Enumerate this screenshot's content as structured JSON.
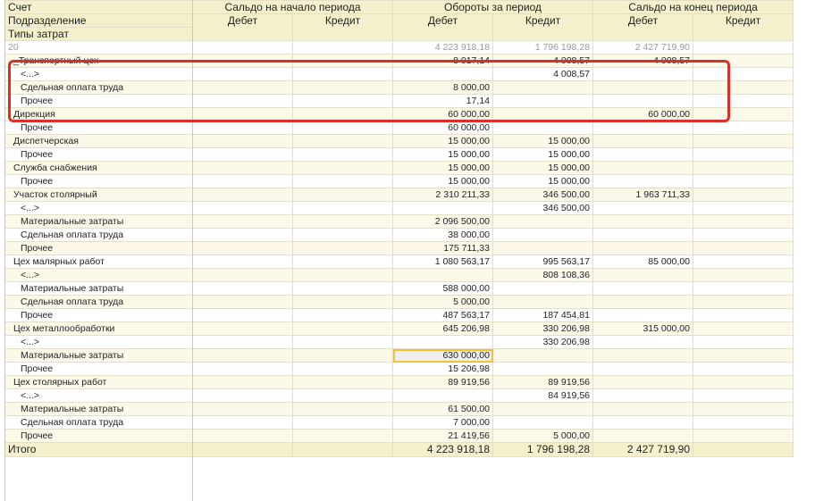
{
  "header": {
    "col_account": "Счет",
    "col_department": "Подразделение",
    "col_cost_type": "Типы затрат",
    "group_opening": "Сальдо на начало периода",
    "group_turnover": "Обороты за период",
    "group_closing": "Сальдо на конец периода",
    "debit": "Дебет",
    "credit": "Кредит"
  },
  "rows": [
    {
      "level": 0,
      "label": "20",
      "od": "",
      "oc": "",
      "td": "4 223 918,18",
      "tc": "1 796 198,28",
      "cd": "2 427 719,90",
      "cc": ""
    },
    {
      "level": 1,
      "label": "_Транспортный цех",
      "od": "",
      "oc": "",
      "td": "8 017,14",
      "tc": "4 008,57",
      "cd": "4 008,57",
      "cc": ""
    },
    {
      "level": 2,
      "label": "<...>",
      "od": "",
      "oc": "",
      "td": "",
      "tc": "4 008,57",
      "cd": "",
      "cc": ""
    },
    {
      "level": 2,
      "label": "Сдельная оплата труда",
      "od": "",
      "oc": "",
      "td": "8 000,00",
      "tc": "",
      "cd": "",
      "cc": ""
    },
    {
      "level": 2,
      "label": "Прочее",
      "od": "",
      "oc": "",
      "td": "17,14",
      "tc": "",
      "cd": "",
      "cc": ""
    },
    {
      "level": 1,
      "label": "Дирекция",
      "od": "",
      "oc": "",
      "td": "60 000,00",
      "tc": "",
      "cd": "60 000,00",
      "cc": ""
    },
    {
      "level": 2,
      "label": "Прочее",
      "od": "",
      "oc": "",
      "td": "60 000,00",
      "tc": "",
      "cd": "",
      "cc": ""
    },
    {
      "level": 1,
      "label": "Диспетчерская",
      "od": "",
      "oc": "",
      "td": "15 000,00",
      "tc": "15 000,00",
      "cd": "",
      "cc": ""
    },
    {
      "level": 2,
      "label": "Прочее",
      "od": "",
      "oc": "",
      "td": "15 000,00",
      "tc": "15 000,00",
      "cd": "",
      "cc": ""
    },
    {
      "level": 1,
      "label": "Служба снабжения",
      "od": "",
      "oc": "",
      "td": "15 000,00",
      "tc": "15 000,00",
      "cd": "",
      "cc": ""
    },
    {
      "level": 2,
      "label": "Прочее",
      "od": "",
      "oc": "",
      "td": "15 000,00",
      "tc": "15 000,00",
      "cd": "",
      "cc": ""
    },
    {
      "level": 1,
      "label": "Участок столярный",
      "od": "",
      "oc": "",
      "td": "2 310 211,33",
      "tc": "346 500,00",
      "cd": "1 963 711,33",
      "cc": ""
    },
    {
      "level": 2,
      "label": "<...>",
      "od": "",
      "oc": "",
      "td": "",
      "tc": "346 500,00",
      "cd": "",
      "cc": ""
    },
    {
      "level": 2,
      "label": "Материальные затраты",
      "od": "",
      "oc": "",
      "td": "2 096 500,00",
      "tc": "",
      "cd": "",
      "cc": ""
    },
    {
      "level": 2,
      "label": "Сдельная оплата труда",
      "od": "",
      "oc": "",
      "td": "38 000,00",
      "tc": "",
      "cd": "",
      "cc": ""
    },
    {
      "level": 2,
      "label": "Прочее",
      "od": "",
      "oc": "",
      "td": "175 711,33",
      "tc": "",
      "cd": "",
      "cc": ""
    },
    {
      "level": 1,
      "label": "Цех малярных работ",
      "od": "",
      "oc": "",
      "td": "1 080 563,17",
      "tc": "995 563,17",
      "cd": "85 000,00",
      "cc": ""
    },
    {
      "level": 2,
      "label": "<...>",
      "od": "",
      "oc": "",
      "td": "",
      "tc": "808 108,36",
      "cd": "",
      "cc": ""
    },
    {
      "level": 2,
      "label": "Материальные затраты",
      "od": "",
      "oc": "",
      "td": "588 000,00",
      "tc": "",
      "cd": "",
      "cc": ""
    },
    {
      "level": 2,
      "label": "Сдельная оплата труда",
      "od": "",
      "oc": "",
      "td": "5 000,00",
      "tc": "",
      "cd": "",
      "cc": ""
    },
    {
      "level": 2,
      "label": "Прочее",
      "od": "",
      "oc": "",
      "td": "487 563,17",
      "tc": "187 454,81",
      "cd": "",
      "cc": ""
    },
    {
      "level": 1,
      "label": "Цех металлообработки",
      "od": "",
      "oc": "",
      "td": "645 206,98",
      "tc": "330 206,98",
      "cd": "315 000,00",
      "cc": ""
    },
    {
      "level": 2,
      "label": "<...>",
      "od": "",
      "oc": "",
      "td": "",
      "tc": "330 206,98",
      "cd": "",
      "cc": ""
    },
    {
      "level": 2,
      "label": "Материальные затраты",
      "od": "",
      "oc": "",
      "td": "630 000,00",
      "tc": "",
      "cd": "",
      "cc": "",
      "selected": true
    },
    {
      "level": 2,
      "label": "Прочее",
      "od": "",
      "oc": "",
      "td": "15 206,98",
      "tc": "",
      "cd": "",
      "cc": ""
    },
    {
      "level": 1,
      "label": "Цех столярных работ",
      "od": "",
      "oc": "",
      "td": "89 919,56",
      "tc": "89 919,56",
      "cd": "",
      "cc": ""
    },
    {
      "level": 2,
      "label": "<...>",
      "od": "",
      "oc": "",
      "td": "",
      "tc": "84 919,56",
      "cd": "",
      "cc": ""
    },
    {
      "level": 2,
      "label": "Материальные затраты",
      "od": "",
      "oc": "",
      "td": "61 500,00",
      "tc": "",
      "cd": "",
      "cc": ""
    },
    {
      "level": 2,
      "label": "Сдельная оплата труда",
      "od": "",
      "oc": "",
      "td": "7 000,00",
      "tc": "",
      "cd": "",
      "cc": ""
    },
    {
      "level": 2,
      "label": "Прочее",
      "od": "",
      "oc": "",
      "td": "21 419,56",
      "tc": "5 000,00",
      "cd": "",
      "cc": ""
    }
  ],
  "total": {
    "label": "Итого",
    "td": "4 223 918,18",
    "tc": "1 796 198,28",
    "cd": "2 427 719,90"
  },
  "colors": {
    "header_bg": "#f5f0cc",
    "highlight": "#d8302a",
    "selected_outline": "#f0c040"
  }
}
